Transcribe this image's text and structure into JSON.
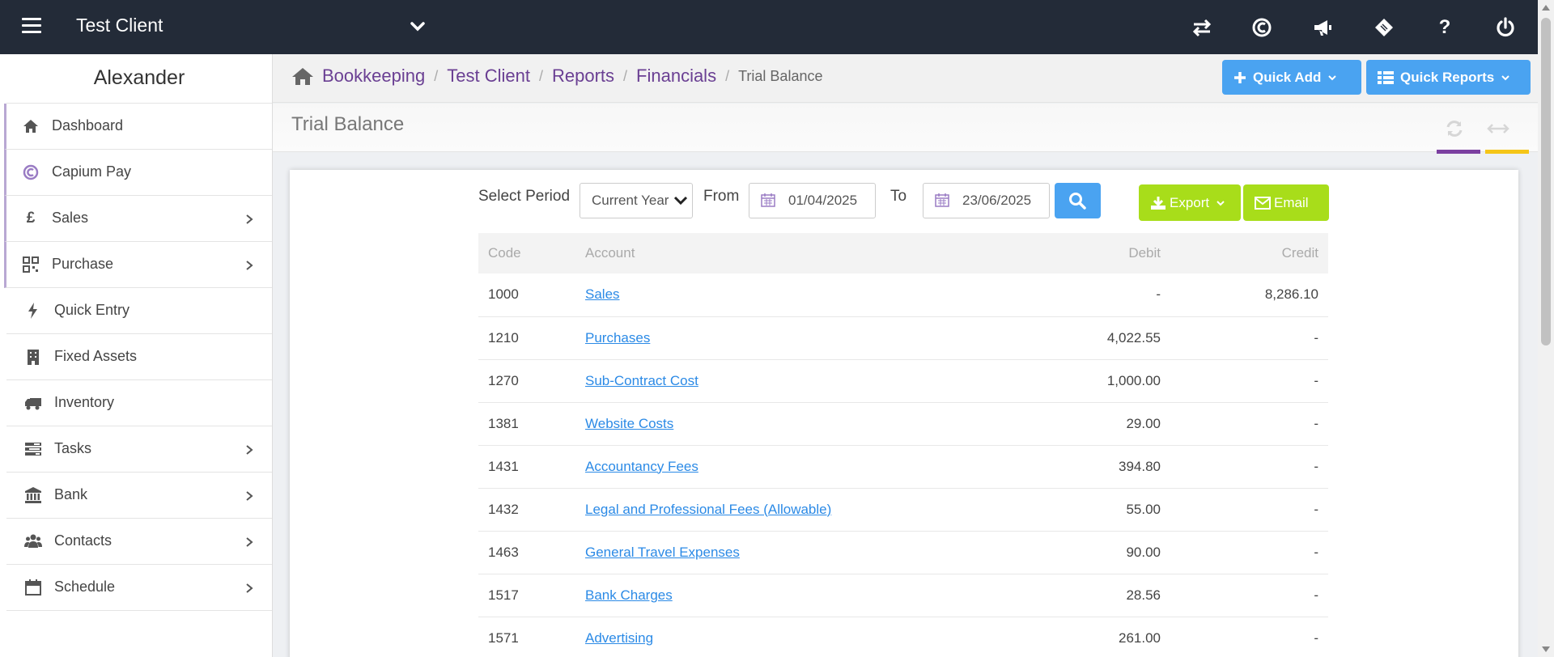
{
  "topbar": {
    "client_name": "Test Client",
    "icons": [
      "switch-icon",
      "capium-icon",
      "megaphone-icon",
      "ticket-icon",
      "help-icon",
      "power-icon"
    ],
    "help_glyph": "?"
  },
  "sidebar": {
    "user_name": "Alexander",
    "items": [
      {
        "label": "Dashboard",
        "icon": "home-icon"
      },
      {
        "label": "Capium Pay",
        "icon": "capium-pay-icon"
      },
      {
        "label": "Sales",
        "icon": "pound-icon",
        "glyph": "£"
      },
      {
        "label": "Purchase",
        "icon": "qrcode-icon"
      },
      {
        "label": "Quick Entry",
        "icon": "bolt-icon"
      },
      {
        "label": "Fixed Assets",
        "icon": "building-icon"
      },
      {
        "label": "Inventory",
        "icon": "truck-icon"
      },
      {
        "label": "Tasks",
        "icon": "tasks-icon"
      },
      {
        "label": "Bank",
        "icon": "bank-icon"
      },
      {
        "label": "Contacts",
        "icon": "users-icon"
      },
      {
        "label": "Schedule",
        "icon": "calendar-icon"
      }
    ]
  },
  "breadcrumb": {
    "items": [
      "Bookkeeping",
      "Test Client",
      "Reports",
      "Financials"
    ],
    "current": "Trial Balance",
    "separator": "/"
  },
  "header_buttons": {
    "quick_add": "Quick Add",
    "quick_reports": "Quick Reports"
  },
  "page": {
    "title": "Trial Balance"
  },
  "filters": {
    "select_period_label": "Select Period",
    "period_value": "Current Year",
    "from_label": "From",
    "from_date": "01/04/2025",
    "to_label": "To",
    "to_date": "23/06/2025",
    "export_label": "Export",
    "email_label": "Email"
  },
  "table": {
    "headers": {
      "code": "Code",
      "account": "Account",
      "debit": "Debit",
      "credit": "Credit"
    },
    "rows": [
      {
        "code": "1000",
        "account": "Sales",
        "debit": "-",
        "credit": "8,286.10"
      },
      {
        "code": "1210",
        "account": "Purchases",
        "debit": "4,022.55",
        "credit": "-"
      },
      {
        "code": "1270",
        "account": "Sub-Contract Cost",
        "debit": "1,000.00",
        "credit": "-"
      },
      {
        "code": "1381",
        "account": "Website Costs",
        "debit": "29.00",
        "credit": "-"
      },
      {
        "code": "1431",
        "account": "Accountancy Fees",
        "debit": "394.80",
        "credit": "-"
      },
      {
        "code": "1432",
        "account": "Legal and Professional Fees (Allowable)",
        "debit": "55.00",
        "credit": "-"
      },
      {
        "code": "1463",
        "account": "General Travel Expenses",
        "debit": "90.00",
        "credit": "-"
      },
      {
        "code": "1517",
        "account": "Bank Charges",
        "debit": "28.56",
        "credit": "-"
      },
      {
        "code": "1571",
        "account": "Advertising",
        "debit": "261.00",
        "credit": "-"
      }
    ]
  },
  "colors": {
    "topbar": "#232b38",
    "brand_purple": "#6a3f93",
    "primary_blue": "#4aa3f1",
    "export_green": "#a8dd1a",
    "link_blue": "#2b8ae6",
    "accent_purple_bar": "#7b3fa0",
    "accent_yellow_bar": "#f5c518"
  }
}
